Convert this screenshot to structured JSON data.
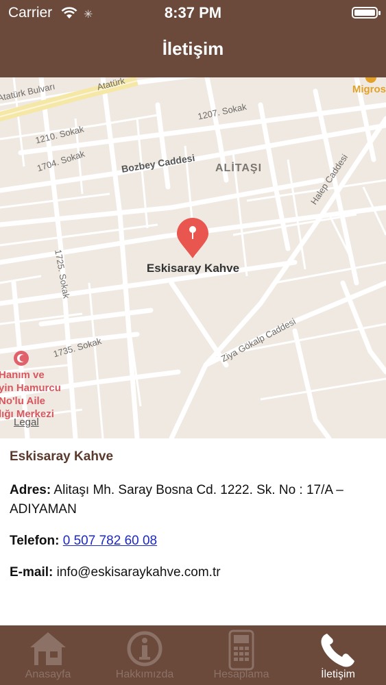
{
  "status_bar": {
    "carrier": "Carrier",
    "time": "8:37 PM"
  },
  "header": {
    "title": "İletişim"
  },
  "map": {
    "pin_label": "Eskisaray Kahve",
    "area_label": "ALİTAŞI",
    "legal": "Legal",
    "poi_lines": [
      "Hanım ve",
      "yin Hamurcu",
      "No'lu Aile",
      "lığı Merkezi"
    ],
    "poi_brand": "Migros",
    "streets": [
      "Atatürk Bulvarı",
      "Atatürk",
      "1207. Sokak",
      "1210. Sokak",
      "1704. Sokak",
      "Bozbey Caddesi",
      "Halep Caddesi",
      "1725. Sokak",
      "1735. Sokak",
      "Ziya Gökalp Caddesi"
    ]
  },
  "info": {
    "name": "Eskisaray Kahve",
    "address_label": "Adres:",
    "address": "Alitaşı Mh. Saray Bosna Cd. 1222. Sk. No : 17/A – ADIYAMAN",
    "phone_label": "Telefon:",
    "phone": "0 507 782 60 08",
    "email_label": "E-mail:",
    "email": "info@eskisaraykahve.com.tr"
  },
  "tabs": [
    {
      "label": "Anasayfa",
      "icon": "home-icon"
    },
    {
      "label": "Hakkımızda",
      "icon": "info-icon"
    },
    {
      "label": "Hesaplama",
      "icon": "calculator-icon"
    },
    {
      "label": "İletişim",
      "icon": "phone-icon"
    }
  ],
  "colors": {
    "brand": "#6b4a3c",
    "pin": "#e8564f",
    "link": "#1b27c9"
  }
}
